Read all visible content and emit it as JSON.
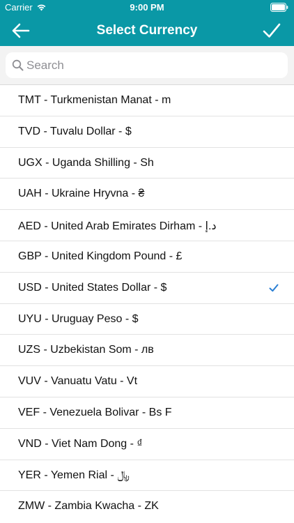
{
  "status_bar": {
    "carrier": "Carrier",
    "time": "9:00 PM",
    "wifi_icon": "wifi-icon",
    "battery_icon": "battery-icon"
  },
  "nav": {
    "title": "Select Currency",
    "back_icon": "arrow-left-icon",
    "done_icon": "checkmark-icon"
  },
  "search": {
    "placeholder": "Search",
    "value": ""
  },
  "currencies": [
    {
      "label": "TMT - Turkmenistan Manat - m",
      "selected": false
    },
    {
      "label": "TVD - Tuvalu Dollar - $",
      "selected": false
    },
    {
      "label": "UGX - Uganda Shilling - Sh",
      "selected": false
    },
    {
      "label": "UAH - Ukraine Hryvna - ₴",
      "selected": false
    },
    {
      "label": "AED - United Arab Emirates Dirham - د.إ",
      "selected": false
    },
    {
      "label": "GBP - United Kingdom Pound - £",
      "selected": false
    },
    {
      "label": "USD - United States Dollar - $",
      "selected": true
    },
    {
      "label": "UYU - Uruguay Peso - $",
      "selected": false
    },
    {
      "label": "UZS - Uzbekistan Som - лв",
      "selected": false
    },
    {
      "label": "VUV - Vanuatu Vatu - Vt",
      "selected": false
    },
    {
      "label": "VEF - Venezuela Bolivar - Bs F",
      "selected": false
    },
    {
      "label": "VND - Viet Nam Dong - ₫",
      "selected": false
    },
    {
      "label": "YER - Yemen Rial - ﷼",
      "selected": false
    },
    {
      "label": "ZMW - Zambia Kwacha - ZK",
      "selected": false
    }
  ],
  "colors": {
    "nav_background": "#0a98a6",
    "selected_check": "#2a7fd4",
    "search_background": "#f3f3f3"
  }
}
